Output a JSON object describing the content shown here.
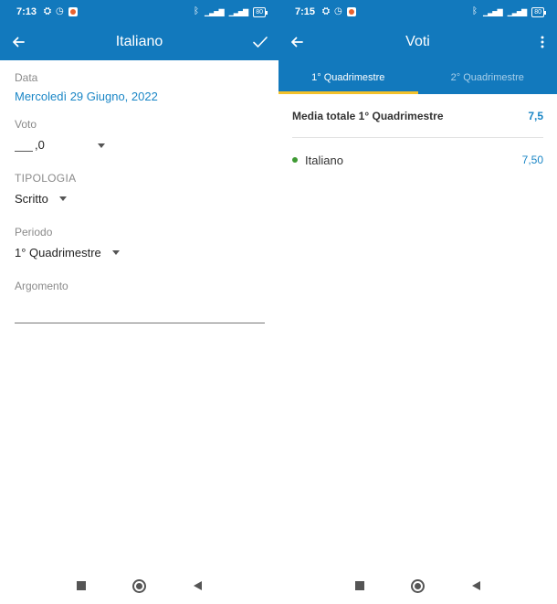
{
  "colors": {
    "primary": "#1279bd",
    "accent_link": "#1a86c6",
    "tab_indicator": "#f3c12a",
    "grade_dot": "#3e9a33"
  },
  "left": {
    "status": {
      "time": "7:13",
      "battery": "80"
    },
    "app_bar": {
      "back_icon": "arrow-left-icon",
      "title": "Italiano",
      "confirm_icon": "check-icon"
    },
    "form": {
      "data_label": "Data",
      "data_value": "Mercoledì 29 Giugno, 2022",
      "voto_label": "Voto",
      "voto_decimal": ",0",
      "tipologia_label": "TIPOLOGIA",
      "tipologia_value": "Scritto",
      "periodo_label": "Periodo",
      "periodo_value": "1° Quadrimestre",
      "argomento_label": "Argomento"
    }
  },
  "right": {
    "status": {
      "time": "7:15",
      "battery": "80"
    },
    "app_bar": {
      "back_icon": "arrow-left-icon",
      "title": "Voti",
      "menu_icon": "more-vertical-icon"
    },
    "tabs": [
      {
        "label": "1° Quadrimestre",
        "active": true
      },
      {
        "label": "2° Quadrimestre",
        "active": false
      }
    ],
    "summary": {
      "label": "Media totale 1° Quadrimestre",
      "value": "7,5"
    },
    "subjects": [
      {
        "name": "Italiano",
        "value": "7,50"
      }
    ]
  }
}
